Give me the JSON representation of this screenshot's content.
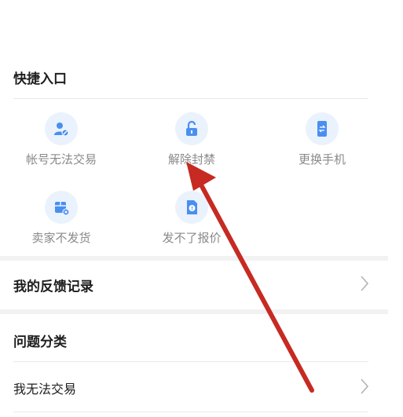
{
  "quick_entry": {
    "title": "快捷入口",
    "items": [
      {
        "label": "帐号无法交易",
        "icon": "user-blocked-icon"
      },
      {
        "label": "解除封禁",
        "icon": "unlock-icon"
      },
      {
        "label": "更换手机",
        "icon": "phone-swap-icon"
      },
      {
        "label": "卖家不发货",
        "icon": "package-cancel-icon"
      },
      {
        "label": "发不了报价",
        "icon": "document-alert-icon"
      }
    ]
  },
  "feedback_record": {
    "label": "我的反馈记录",
    "icon": "chevron-right-icon"
  },
  "issue_category": {
    "title": "问题分类",
    "items": [
      {
        "label": "我无法交易",
        "icon": "chevron-right-icon"
      }
    ]
  },
  "colors": {
    "icon_bg": "#e9f2fd",
    "icon_fg": "#4a8ff0",
    "annotation_arrow": "#c62a22"
  }
}
